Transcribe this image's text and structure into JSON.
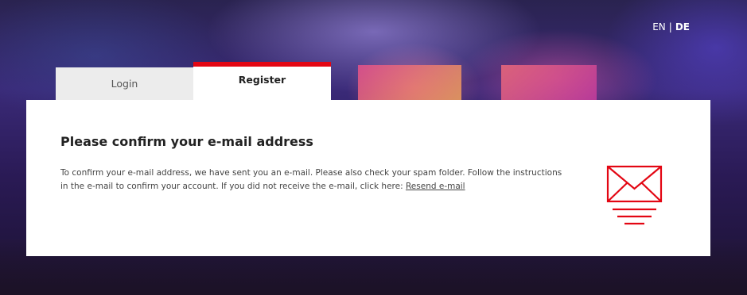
{
  "language": {
    "en_label": "EN",
    "separator": "|",
    "de_label": "DE",
    "active": "DE"
  },
  "tabs": [
    {
      "label": "Login",
      "active": false
    },
    {
      "label": "Register",
      "active": true
    }
  ],
  "confirm": {
    "title": "Please confirm your e-mail address",
    "body": "To confirm your e-mail address, we have sent you an e-mail. Please also check your spam folder. Follow the instructions in the e-mail to confirm your account. If you did not receive the e-mail, click here:",
    "resend_link": "Resend e-mail",
    "icon": "envelope-icon"
  },
  "colors": {
    "accent": "#e30613",
    "card_bg": "#ffffff",
    "inactive_tab_bg": "#ececec"
  }
}
